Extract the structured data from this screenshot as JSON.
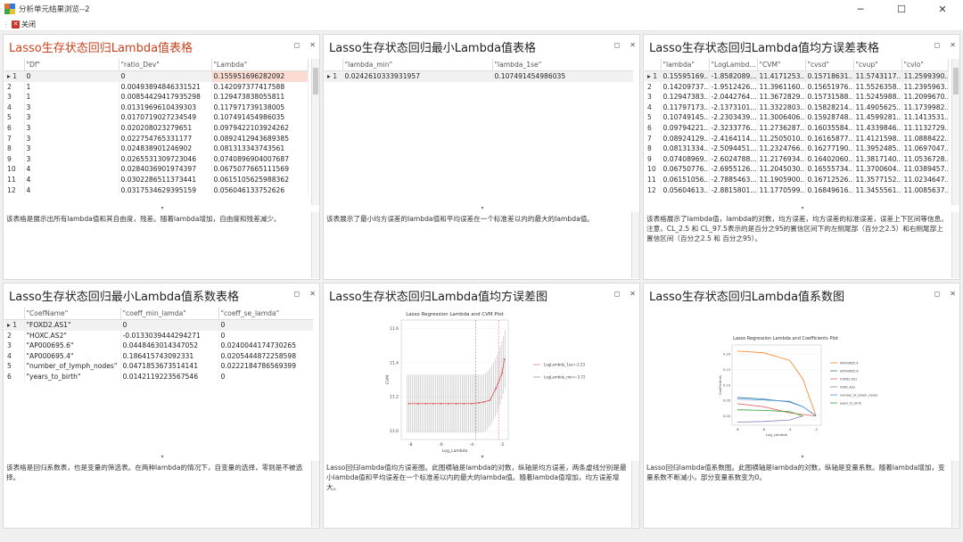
{
  "window": {
    "title": "分析单元结果浏览--2"
  },
  "menu": {
    "close_label": "关闭"
  },
  "panels": [
    {
      "title": "Lasso生存状态回归Lambda值表格",
      "columns": [
        "\"Df\"",
        "\"ratio_Dev\"",
        "\"Lambda\""
      ],
      "rows": [
        [
          "1",
          "0",
          "0",
          "0.155951696282092"
        ],
        [
          "2",
          "1",
          "0.00493894846331521",
          "0.142097377417588"
        ],
        [
          "3",
          "1",
          "0.00854429417935298",
          "0.129473838055811"
        ],
        [
          "4",
          "3",
          "0.0131969610439303",
          "0.117971739138005"
        ],
        [
          "5",
          "3",
          "0.0170719027234549",
          "0.107491454986035"
        ],
        [
          "6",
          "3",
          "0.020208023279651",
          "0.0979422103924262"
        ],
        [
          "7",
          "3",
          "0.022754765331177",
          "0.0892412943689385"
        ],
        [
          "8",
          "3",
          "0.024838901246902",
          "0.081313343743561"
        ],
        [
          "9",
          "3",
          "0.0265531309723046",
          "0.0740896904007687"
        ],
        [
          "10",
          "4",
          "0.0284036901974397",
          "0.0675077665111569"
        ],
        [
          "11",
          "4",
          "0.0302286511373441",
          "0.0615105625988362"
        ],
        [
          "12",
          "4",
          "0.0317534629395159",
          "0.056046133752626"
        ]
      ],
      "description": "该表格是展示出所有lambda值和其自由度，残差。随着lambda增加，自由度和残差减少。"
    },
    {
      "title": "Lasso生存状态回归最小Lambda值表格",
      "columns": [
        "\"lambda_min\"",
        "\"lambda_1se\""
      ],
      "rows": [
        [
          "1",
          "0.0242610333931957",
          "0.107491454986035"
        ]
      ],
      "description": "该表展示了最小均方误差的lambda值和平均误差在一个标准差以内的最大的lambda值。"
    },
    {
      "title": "Lasso生存状态回归Lambda值均方误差表格",
      "columns": [
        "\"lambda\"",
        "\"LogLambd...",
        "\"CVM\"",
        "\"cvsd\"",
        "\"cvup\"",
        "\"cvlo\""
      ],
      "rows": [
        [
          "1",
          "0.15595169...",
          "-1.8582089...",
          "11.4171253...",
          "0.15718631...",
          "11.5743117...",
          "11.2599390..."
        ],
        [
          "2",
          "0.14209737...",
          "-1.9512426...",
          "11.3961160...",
          "0.15651976...",
          "11.5526358...",
          "11.2395963..."
        ],
        [
          "3",
          "0.12947383...",
          "-2.0442764...",
          "11.3672829...",
          "0.15731588...",
          "11.5245988...",
          "11.2099670..."
        ],
        [
          "4",
          "0.11797173...",
          "-2.1373101...",
          "11.3322803...",
          "0.15828214...",
          "11.4905625...",
          "11.1739982..."
        ],
        [
          "5",
          "0.10749145...",
          "-2.2303439...",
          "11.3006406...",
          "0.15928748...",
          "11.4599281...",
          "11.1413531..."
        ],
        [
          "6",
          "0.09794221...",
          "-2.3233776...",
          "11.2736287...",
          "0.16035584...",
          "11.4339846...",
          "11.1132729..."
        ],
        [
          "7",
          "0.08924129...",
          "-2.4164114...",
          "11.2505010...",
          "0.16165877...",
          "11.4121598...",
          "11.0888422..."
        ],
        [
          "8",
          "0.08131334...",
          "-2.5094451...",
          "11.2324766...",
          "0.16277190...",
          "11.3952485...",
          "11.0697047..."
        ],
        [
          "9",
          "0.07408969...",
          "-2.6024788...",
          "11.2176934...",
          "0.16402060...",
          "11.3817140...",
          "11.0536728..."
        ],
        [
          "10",
          "0.06750776...",
          "-2.6955126...",
          "11.2045030...",
          "0.16555734...",
          "11.3700604...",
          "11.0389457..."
        ],
        [
          "11",
          "0.06151056...",
          "-2.7885463...",
          "11.1905900...",
          "0.16712526...",
          "11.3577152...",
          "11.0234647..."
        ],
        [
          "12",
          "0.05604613...",
          "-2.8815801...",
          "11.1770599...",
          "0.16849616...",
          "11.3455561...",
          "11.0085637..."
        ]
      ],
      "description": "该表格展示了lambda值，lambda的对数，均方误差，均方误差的标准误差，误差上下区间等信息。注意，CL_2.5 和 CL_97.5表示的是百分之95的置信区间下的左侧尾部（百分之2.5）和右侧尾部上置信区间（百分之2.5 和 百分之95）。"
    },
    {
      "title": "Lasso生存状态回归最小Lambda值系数表格",
      "columns": [
        "\"CoefName\"",
        "\"coeff_min_lamda\"",
        "\"coeff_se_lamda\""
      ],
      "rows": [
        [
          "1",
          "\"FOXD2.AS1\"",
          "0",
          "0"
        ],
        [
          "2",
          "\"HOXC.AS2\"",
          "-0.0133039444294271",
          "0"
        ],
        [
          "3",
          "\"AP000695.6\"",
          "0.0448463014347052",
          "0.0240044174730265"
        ],
        [
          "4",
          "\"AP000695.4\"",
          "0.186415743092331",
          "0.0205444872258598"
        ],
        [
          "5",
          "\"number_of_lymph_nodes\"",
          "0.0471853673514141",
          "0.0222184786569399"
        ],
        [
          "6",
          "\"years_to_birth\"",
          "0.0142119223567546",
          "0"
        ]
      ],
      "description": "该表格是回归系数表，也是变量的筛选表。在两种lambda的情况下，自变量的选择，零则是不被选择。"
    },
    {
      "title": "Lasso生存状态回归Lambda值均方误差图",
      "description": "Lasso回归lambda值均方误差图。此图横轴是lambda的对数，纵轴是均方误差，两条虚线分别是最小lambda值和平均误差在一个标准差以内的最大的lambda值。随着lambda值增加，均方误差增大。"
    },
    {
      "title": "Lasso生存状态回归Lambda值系数图",
      "description": "Lasso回归lambda值系数图。此图横轴是lambda的对数，纵轴是变量系数。随着lambda增加，变量系数不断减小，部分变量系数变为0。"
    }
  ],
  "chart_data": [
    {
      "type": "line",
      "title": "Lasso Regression Lambda and CVM Plot",
      "xlabel": "Log_Lambda",
      "ylabel": "CVM",
      "y_ticks": [
        "11.0",
        "11.2",
        "11.4",
        "11.6"
      ],
      "x_ticks": [
        "-8",
        "-6",
        "-4",
        "-2"
      ],
      "x": [
        -8.1,
        -7.5,
        -7.0,
        -6.5,
        -6.0,
        -5.5,
        -5.0,
        -4.5,
        -4.0,
        -3.5,
        -3.2,
        -2.8,
        -2.4,
        -2.0,
        -1.86
      ],
      "values": [
        11.16,
        11.16,
        11.16,
        11.16,
        11.16,
        11.16,
        11.16,
        11.16,
        11.16,
        11.165,
        11.17,
        11.18,
        11.25,
        11.34,
        11.42
      ],
      "legend": [
        "LogLambda_1se=-2.23",
        "LogLambda_min=-3.72"
      ],
      "vlines": [
        -2.23,
        -3.72
      ]
    },
    {
      "type": "line",
      "title": "Lasso Regression Lambda and Coefficients Plot",
      "xlabel": "Log_Lambda",
      "ylabel": "Coefficients",
      "x_ticks": [
        "-8",
        "-6",
        "-4",
        "-2"
      ],
      "y_ticks": [
        "0.00",
        "0.05",
        "0.10",
        "0.15",
        "0.20"
      ],
      "series": [
        {
          "name": "AP000695.4",
          "color": "#f58220",
          "x": [
            -8,
            -6,
            -4,
            -3,
            -2
          ],
          "values": [
            0.21,
            0.205,
            0.18,
            0.12,
            0
          ]
        },
        {
          "name": "AP000695.6",
          "color": "#2e7d9a",
          "x": [
            -8,
            -6,
            -4,
            -3,
            -2
          ],
          "values": [
            0.06,
            0.055,
            0.045,
            0.03,
            0
          ]
        },
        {
          "name": "FOXD2.AS1",
          "color": "#e06666",
          "x": [
            -8,
            -6,
            -4,
            -2
          ],
          "values": [
            0.04,
            0.03,
            0.01,
            0
          ]
        },
        {
          "name": "HOXC.AS2",
          "color": "#8e7cc3",
          "x": [
            -8,
            -6,
            -4,
            -3
          ],
          "values": [
            -0.02,
            -0.018,
            -0.013,
            0
          ]
        },
        {
          "name": "number_of_lymph_nodes",
          "color": "#4a90d9",
          "x": [
            -8,
            -6,
            -4,
            -3,
            -2
          ],
          "values": [
            0.055,
            0.052,
            0.047,
            0.03,
            0
          ]
        },
        {
          "name": "years_to_birth",
          "color": "#2ca02c",
          "x": [
            -8,
            -6,
            -4,
            -3
          ],
          "values": [
            0.02,
            0.018,
            0.014,
            0
          ]
        }
      ]
    }
  ]
}
